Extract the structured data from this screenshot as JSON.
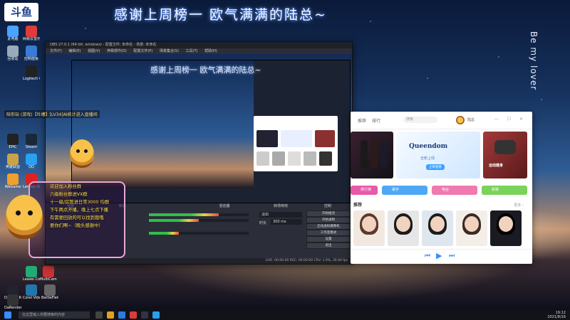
{
  "banner_text": "感谢上周榜一 欧气满满的陆总~",
  "vertical_text": "Be my lover",
  "desktop_logo": "斗鱼",
  "desktop_icons": [
    {
      "label": "此电脑",
      "color": "#4aa3ff"
    },
    {
      "label": "回收站",
      "color": "#9ab"
    },
    {
      "label": "网易云音乐",
      "color": "#e03a3a"
    },
    {
      "label": "控制面板",
      "color": "#3a7bd5"
    },
    {
      "label": "Logitech G HUB",
      "color": "#222"
    },
    {
      "label": "EPIC",
      "color": "#222"
    },
    {
      "label": "英雄联盟",
      "color": "#c9a34a"
    },
    {
      "label": "QQ",
      "color": "#2aa0f0"
    },
    {
      "label": "WeGame",
      "color": "#f0a030"
    },
    {
      "label": "Lenovo Vantage",
      "color": "#d22"
    },
    {
      "label": "Steam",
      "color": "#1b2838"
    },
    {
      "label": "DaVinci Resolve",
      "color": "#223"
    },
    {
      "label": "Leawo Convert",
      "color": "#2a7"
    },
    {
      "label": "MultiCam Capture",
      "color": "#c33"
    },
    {
      "label": "DaRenderd",
      "color": "#333"
    },
    {
      "label": "Corel VideoStud",
      "color": "#27a"
    },
    {
      "label": "BattleField 1",
      "color": "#666"
    }
  ],
  "obs": {
    "title": "OBS 27.0.1 (64-bit, windows) - 配置文件: 未命名 - 场景: 未命名",
    "menus": [
      "文件(F)",
      "编辑(E)",
      "视图(V)",
      "停靠部件(D)",
      "配置文件(P)",
      "场景集合(S)",
      "工具(T)",
      "帮助(H)"
    ],
    "dock_titles": [
      "场景",
      "来源",
      "混音器",
      "转场特效",
      "控制"
    ],
    "controls": [
      "开始推流",
      "开始录制",
      "启动虚拟摄像机",
      "工作室模式",
      "设置",
      "退出"
    ],
    "transition": "淡出",
    "duration_label": "时长",
    "duration_value": "300 ms",
    "status": "LIVE: 00:00:00  REC: 00:00:00  CPU: 1.9%, 30.00 fps"
  },
  "stream_subline": "陪你玩 (游戏)【吐槽】[LV34]AI统计进入直播间",
  "notice_lines": [
    "欢迎加入粉丝群",
    "六级粉丝群进VX群",
    "十一级/房管进日常3000 均群",
    "下午两点开播，晚上七点下播",
    "有需要回放的可以找到我哦",
    "要你们啊~（晚头感谢中）"
  ],
  "music": {
    "nav": [
      "推荐",
      "排行",
      "搜索"
    ],
    "search_placeholder": "搜索",
    "user_name": "陆总",
    "window_controls": "— ☐ ✕",
    "hero_banner_text": "Queendom",
    "hero_banner_sub": "全新上线",
    "hero_banner_button": "立即查看",
    "side_banner_text": "运动健身",
    "tags": [
      "排行榜",
      "歌手",
      "电台",
      "新歌"
    ],
    "section_title": "推荐",
    "section_more": "更多 ›",
    "player_controls": [
      "⏮",
      "▶",
      "⏭"
    ]
  },
  "taskbar": {
    "search_placeholder": "在这里输入你要搜索的内容",
    "time": "19:12",
    "date": "2021/8/16"
  }
}
